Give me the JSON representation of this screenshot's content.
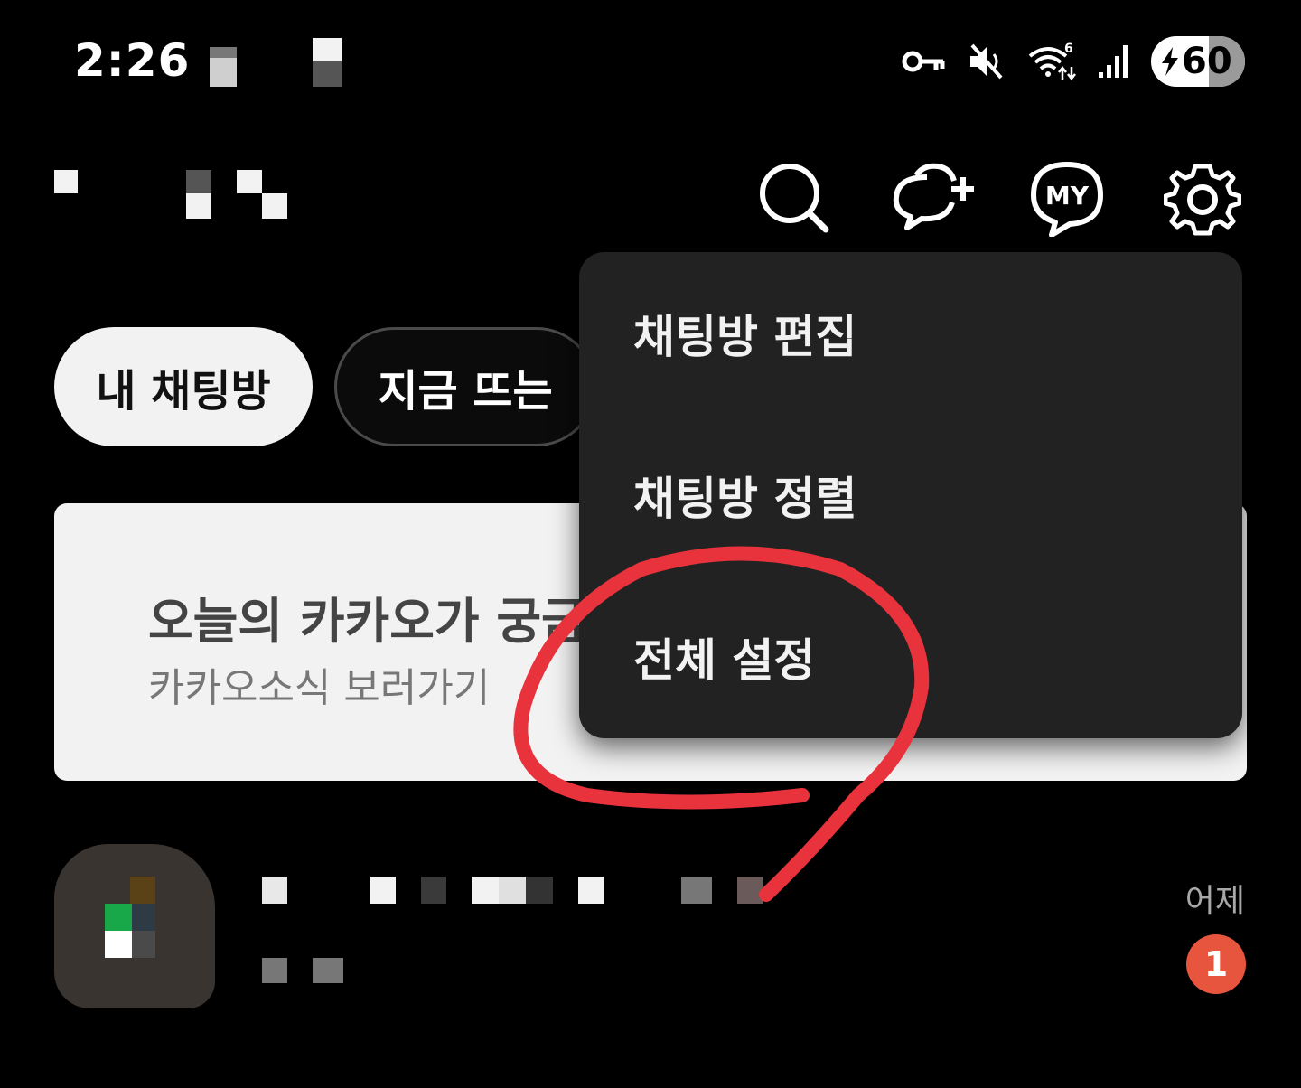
{
  "status_bar": {
    "time": "2:26",
    "battery": "60",
    "icons": [
      "key-icon",
      "mute-icon",
      "wifi-6-icon",
      "signal-icon",
      "battery-charging-icon"
    ]
  },
  "header": {
    "icons": [
      "search-icon",
      "new-chat-icon",
      "my-chat-icon",
      "settings-icon"
    ],
    "my_label": "MY"
  },
  "tabs": [
    {
      "label": "내 채팅방",
      "selected": true
    },
    {
      "label": "지금 뜨는",
      "selected": false
    }
  ],
  "banner": {
    "title": "오늘의 카카오가 궁금",
    "subtitle": "카카오소식 보러가기"
  },
  "chat_list": [
    {
      "time": "어제",
      "unread": "1"
    }
  ],
  "menu": {
    "items": [
      {
        "label": "채팅방 편집"
      },
      {
        "label": "채팅방 정렬"
      },
      {
        "label": "전체 설정"
      }
    ]
  },
  "colors": {
    "background": "#000000",
    "menu_bg": "#222222",
    "badge": "#e8553f",
    "annotation": "#e8323c"
  }
}
